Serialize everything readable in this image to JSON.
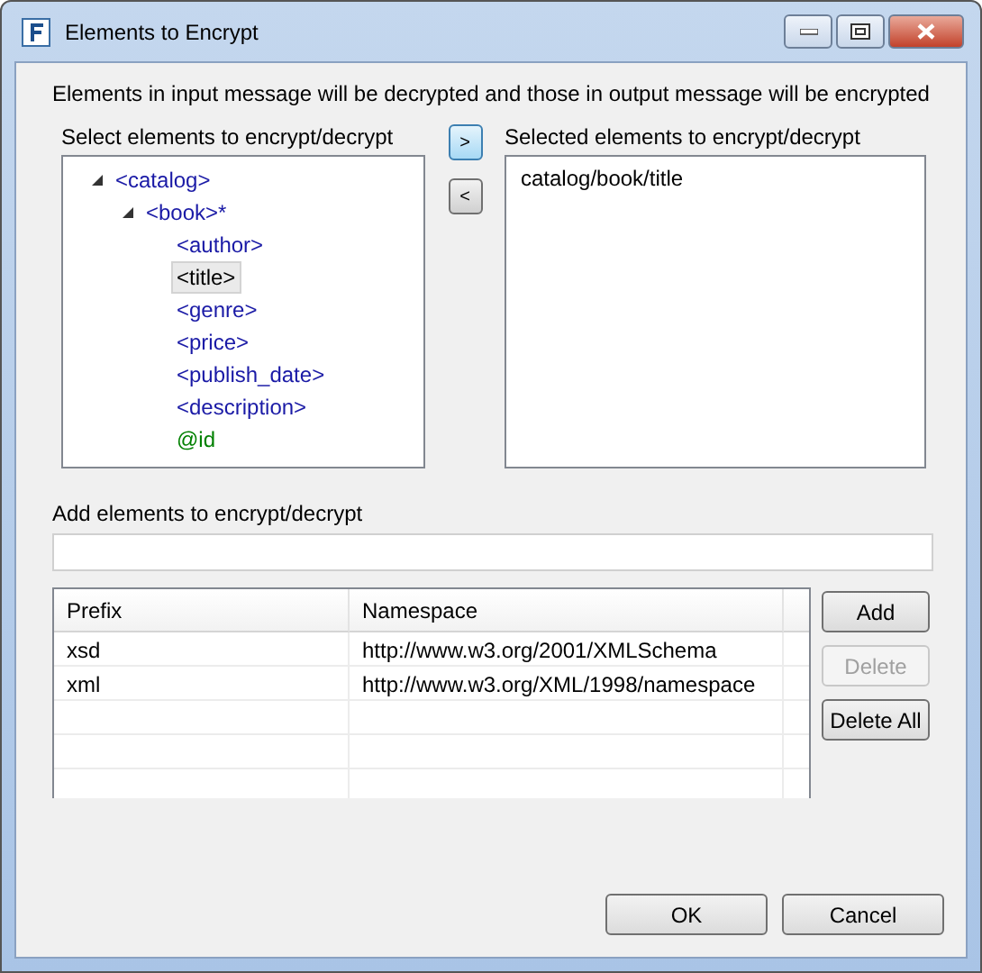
{
  "window": {
    "title": "Elements to Encrypt"
  },
  "description": "Elements in input message will be decrypted and those in output message will be encrypted",
  "source_label": "Select elements to encrypt/decrypt",
  "tree": [
    {
      "label": "<catalog>",
      "kind": "element",
      "expanded": true,
      "selected": false,
      "children": [
        {
          "label": "<book>*",
          "kind": "element",
          "expanded": true,
          "selected": false,
          "children": [
            {
              "label": "<author>",
              "kind": "element",
              "selected": false
            },
            {
              "label": "<title>",
              "kind": "element",
              "selected": true
            },
            {
              "label": "<genre>",
              "kind": "element",
              "selected": false
            },
            {
              "label": "<price>",
              "kind": "element",
              "selected": false
            },
            {
              "label": "<publish_date>",
              "kind": "element",
              "selected": false
            },
            {
              "label": "<description>",
              "kind": "element",
              "selected": false
            },
            {
              "label": "@id",
              "kind": "attribute",
              "selected": false
            }
          ]
        }
      ]
    }
  ],
  "move_buttons": [
    {
      "label": ">",
      "focused": true
    },
    {
      "label": "<",
      "focused": false
    }
  ],
  "target_label": "Selected elements to encrypt/decrypt",
  "selected_items": [
    "catalog/book/title"
  ],
  "add_label": "Add elements to encrypt/decrypt",
  "table": {
    "columns": [
      "Prefix",
      "Namespace"
    ],
    "rows": [
      [
        "xsd",
        "http://www.w3.org/2001/XMLSchema"
      ],
      [
        "xml",
        "http://www.w3.org/XML/1998/namespace"
      ]
    ]
  },
  "table_buttons": [
    {
      "label": "Add",
      "disabled": false
    },
    {
      "label": "Delete",
      "disabled": true
    },
    {
      "label": "Delete All",
      "disabled": false
    }
  ],
  "footer_buttons": [
    "OK",
    "Cancel"
  ]
}
